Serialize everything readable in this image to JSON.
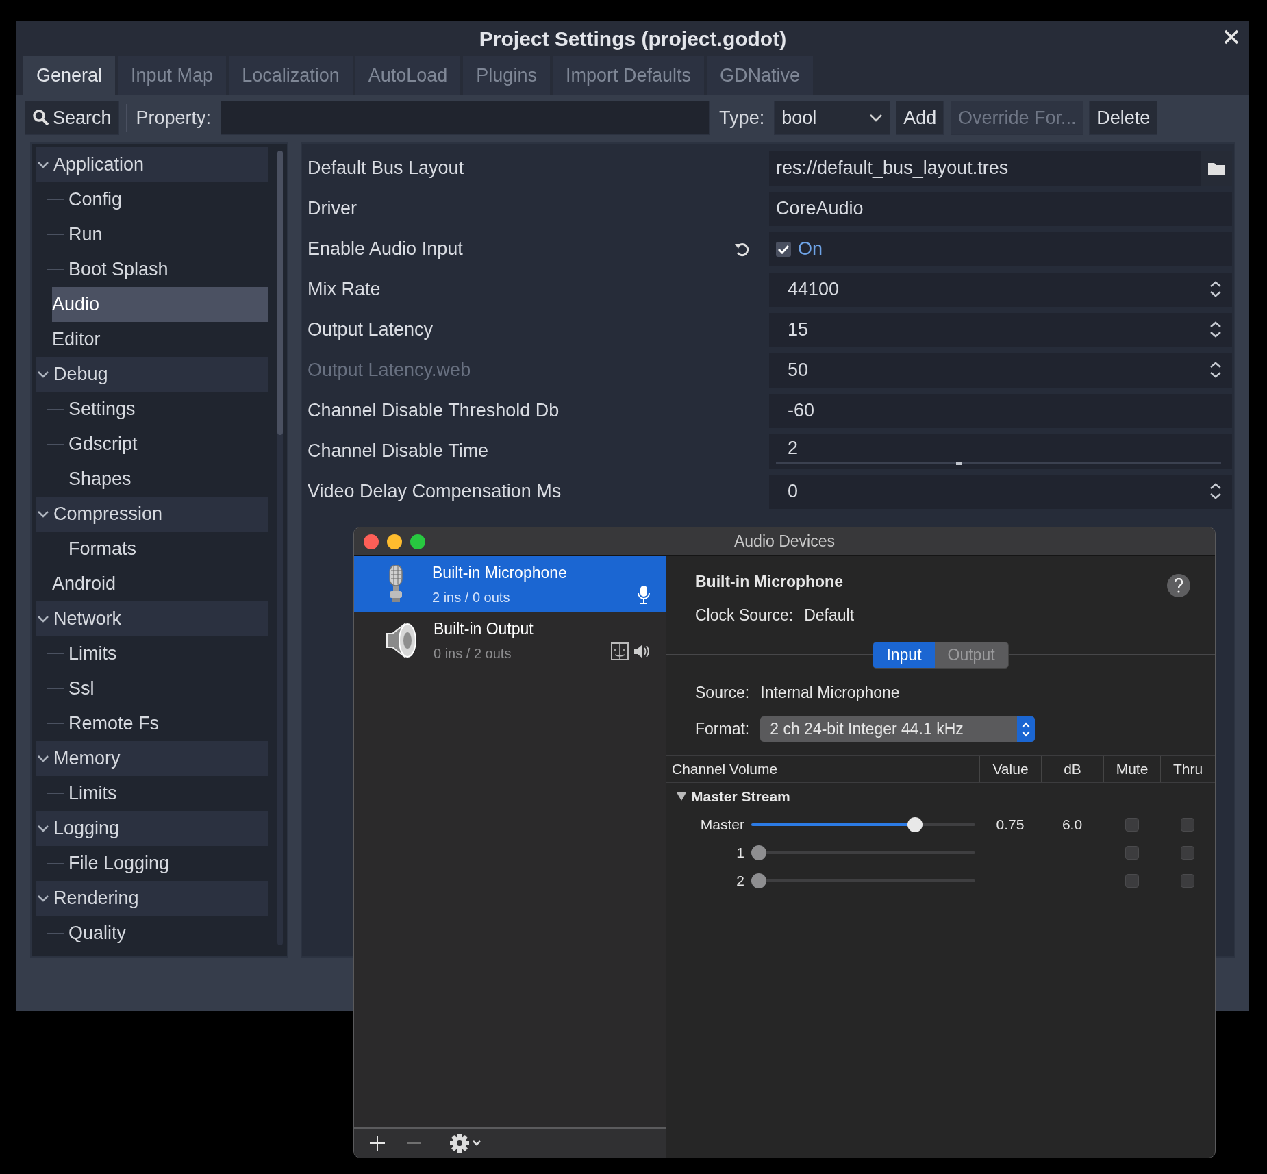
{
  "window": {
    "title": "Project Settings (project.godot)"
  },
  "tabs": [
    {
      "label": "General",
      "selected": true
    },
    {
      "label": "Input Map",
      "selected": false
    },
    {
      "label": "Localization",
      "selected": false
    },
    {
      "label": "AutoLoad",
      "selected": false
    },
    {
      "label": "Plugins",
      "selected": false
    },
    {
      "label": "Import Defaults",
      "selected": false
    },
    {
      "label": "GDNative",
      "selected": false
    }
  ],
  "toolbar": {
    "search": "Search",
    "property_label": "Property:",
    "type_label": "Type:",
    "type_value": "bool",
    "buttons": [
      {
        "label": "Add",
        "disabled": false
      },
      {
        "label": "Override For...",
        "disabled": true
      },
      {
        "label": "Delete",
        "disabled": false
      }
    ]
  },
  "tree": [
    {
      "label": "Application",
      "selected": false,
      "children": [
        {
          "label": "Config",
          "selected": false
        },
        {
          "label": "Run",
          "selected": false
        },
        {
          "label": "Boot Splash",
          "selected": false
        }
      ]
    },
    {
      "label": "Audio",
      "selected": true
    },
    {
      "label": "Editor",
      "selected": false
    },
    {
      "label": "Debug",
      "selected": false,
      "children": [
        {
          "label": "Settings",
          "selected": false
        },
        {
          "label": "Gdscript",
          "selected": false
        },
        {
          "label": "Shapes",
          "selected": false
        }
      ]
    },
    {
      "label": "Compression",
      "selected": false,
      "children": [
        {
          "label": "Formats",
          "selected": false
        }
      ]
    },
    {
      "label": "Android",
      "selected": false
    },
    {
      "label": "Network",
      "selected": false,
      "children": [
        {
          "label": "Limits",
          "selected": false
        },
        {
          "label": "Ssl",
          "selected": false
        },
        {
          "label": "Remote Fs",
          "selected": false
        }
      ]
    },
    {
      "label": "Memory",
      "selected": false,
      "children": [
        {
          "label": "Limits",
          "selected": false
        }
      ]
    },
    {
      "label": "Logging",
      "selected": false,
      "children": [
        {
          "label": "File Logging",
          "selected": false
        }
      ]
    },
    {
      "label": "Rendering",
      "selected": false,
      "children": [
        {
          "label": "Quality",
          "selected": false
        }
      ]
    }
  ],
  "properties": [
    {
      "label": "Default Bus Layout",
      "kind": "path",
      "value": "res://default_bus_layout.tres",
      "dimmed": false,
      "revert": false
    },
    {
      "label": "Driver",
      "kind": "text",
      "value": "CoreAudio",
      "dimmed": false,
      "revert": false
    },
    {
      "label": "Enable Audio Input",
      "kind": "check",
      "value": "On",
      "checked": true,
      "dimmed": false,
      "revert": true
    },
    {
      "label": "Mix Rate",
      "kind": "spin",
      "value": "44100",
      "dimmed": false,
      "revert": false
    },
    {
      "label": "Output Latency",
      "kind": "spin",
      "value": "15",
      "dimmed": false,
      "revert": false
    },
    {
      "label": "Output Latency.web",
      "kind": "spin",
      "value": "50",
      "dimmed": true,
      "revert": false
    },
    {
      "label": "Channel Disable Threshold Db",
      "kind": "number",
      "value": "-60",
      "dimmed": false,
      "revert": false
    },
    {
      "label": "Channel Disable Time",
      "kind": "slider",
      "value": "2",
      "level": 0.405,
      "dimmed": false,
      "revert": false
    },
    {
      "label": "Video Delay Compensation Ms",
      "kind": "spin",
      "value": "0",
      "dimmed": false,
      "revert": false
    }
  ],
  "audio_devices": {
    "title": "Audio Devices",
    "devices": [
      {
        "name": "Built-in Microphone",
        "io": "2 ins / 0 outs",
        "kind": "microphone",
        "selected": true
      },
      {
        "name": "Built-in Output",
        "io": "0 ins / 2 outs",
        "kind": "output",
        "selected": false
      }
    ],
    "detail": {
      "heading": "Built-in Microphone",
      "clock_label": "Clock Source:",
      "clock_value": "Default",
      "modes": [
        {
          "label": "Input",
          "selected": true
        },
        {
          "label": "Output",
          "selected": false
        }
      ],
      "source_label": "Source:",
      "source_value": "Internal Microphone",
      "format_label": "Format:",
      "format_value": "2 ch 24-bit Integer 44.1 kHz",
      "columns": [
        "Channel Volume",
        "Value",
        "dB",
        "Mute",
        "Thru"
      ],
      "groups": [
        {
          "label": "Master Stream",
          "expanded": true,
          "channels": [
            {
              "name": "Master",
              "level": 0.73,
              "value": "0.75",
              "db": "6.0",
              "mute": false,
              "thru": false
            },
            {
              "name": "1",
              "level": 0,
              "mute": false,
              "thru": false
            },
            {
              "name": "2",
              "level": 0,
              "mute": false,
              "thru": false
            }
          ]
        }
      ]
    },
    "toolbar": {
      "remove_disabled": true
    }
  }
}
